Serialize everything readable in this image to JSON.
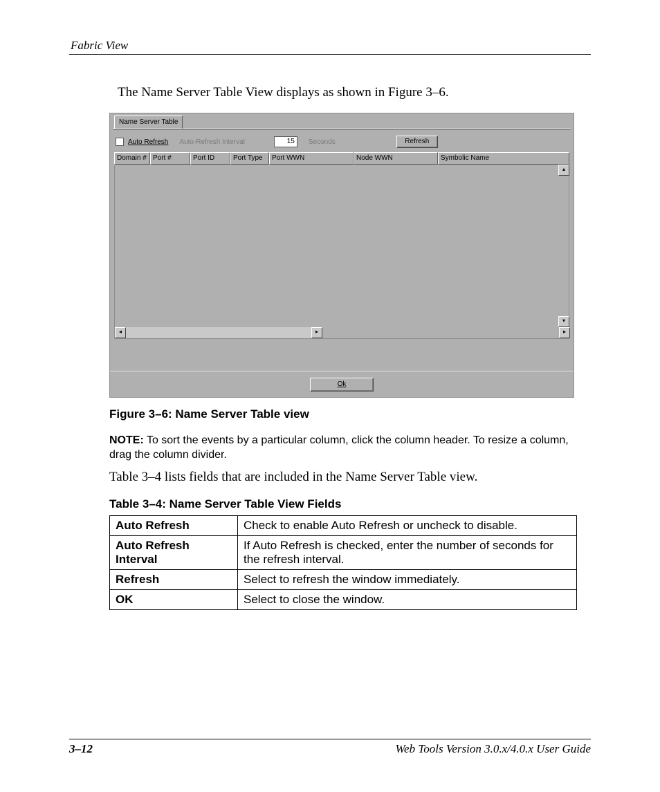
{
  "header": {
    "section": "Fabric View"
  },
  "intro": "The Name Server Table View displays as shown in Figure 3–6.",
  "dialog": {
    "tab": "Name Server Table",
    "auto_refresh_label": "Auto Refresh",
    "interval_label": "Auto-Refresh Interval",
    "interval_value": "15",
    "seconds_label": "Seconds",
    "refresh_btn": "Refresh",
    "ok_btn_key": "O",
    "ok_btn_rest": "k",
    "columns": [
      "Domain #",
      "Port #",
      "Port ID",
      "Port Type",
      "Port WWN",
      "Node WWN",
      "Symbolic Name"
    ]
  },
  "figure_caption": "Figure 3–6:  Name Server Table view",
  "note_label": "NOTE:",
  "note_text": "  To sort the events by a particular column, click the column header. To resize a column, drag the column divider.",
  "para2": "Table 3–4 lists fields that are included in the Name Server Table view.",
  "table_title": "Table 3–4:  Name Server Table View Fields",
  "rows": [
    {
      "k": "Auto Refresh",
      "v": "Check to enable Auto Refresh or uncheck to disable."
    },
    {
      "k": "Auto Refresh Interval",
      "v": "If Auto Refresh is checked, enter the number of seconds for the refresh interval."
    },
    {
      "k": "Refresh",
      "v": "Select to refresh the window immediately."
    },
    {
      "k": "OK",
      "v": "Select to close the window."
    }
  ],
  "footer": {
    "page": "3–12",
    "title": "Web Tools Version 3.0.x/4.0.x User Guide"
  }
}
